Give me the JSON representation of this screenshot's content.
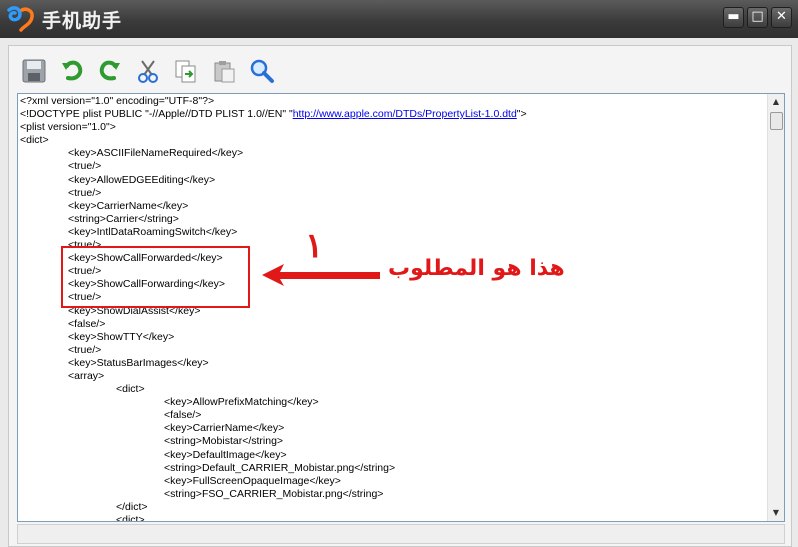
{
  "titlebar": {
    "title": "手机助手",
    "minimize_label": "▬",
    "maximize_label": "□",
    "close_label": "✕"
  },
  "toolbar": {
    "icons": [
      "save-icon",
      "undo-icon",
      "redo-icon",
      "cut-icon",
      "copy-icon",
      "paste-icon",
      "find-icon"
    ]
  },
  "editor": {
    "lines": [
      "<?xml version=\"1.0\" encoding=\"UTF-8\"?>",
      "<!DOCTYPE plist PUBLIC \"-//Apple//DTD PLIST 1.0//EN\" \"",
      "<plist version=\"1.0\">",
      "<dict>",
      "\t<key>ASCIIFileNameRequired</key>",
      "\t<true/>",
      "\t<key>AllowEDGEEditing</key>",
      "\t<true/>",
      "\t<key>CarrierName</key>",
      "\t<string>Carrier</string>",
      "\t<key>IntlDataRoamingSwitch</key>",
      "\t<true/>",
      "\t<key>ShowCallForwarded</key>",
      "\t<true/>",
      "\t<key>ShowCallForwarding</key>",
      "\t<true/>",
      "\t<key>ShowDialAssist</key>",
      "\t<false/>",
      "\t<key>ShowTTY</key>",
      "\t<true/>",
      "\t<key>StatusBarImages</key>",
      "\t<array>",
      "\t\t<dict>",
      "\t\t\t<key>AllowPrefixMatching</key>",
      "\t\t\t<false/>",
      "\t\t\t<key>CarrierName</key>",
      "\t\t\t<string>Mobistar</string>",
      "\t\t\t<key>DefaultImage</key>",
      "\t\t\t<string>Default_CARRIER_Mobistar.png</string>",
      "\t\t\t<key>FullScreenOpaqueImage</key>",
      "\t\t\t<string>FSO_CARRIER_Mobistar.png</string>",
      "\t\t</dict>",
      "\t\t<dict>"
    ],
    "doctype_link": "http://www.apple.com/DTDs/PropertyList-1.0.dtd",
    "doctype_tail": "\">"
  },
  "annotation": {
    "number": "١",
    "text": "هذا هو المطلوب",
    "color": "#e01818"
  }
}
